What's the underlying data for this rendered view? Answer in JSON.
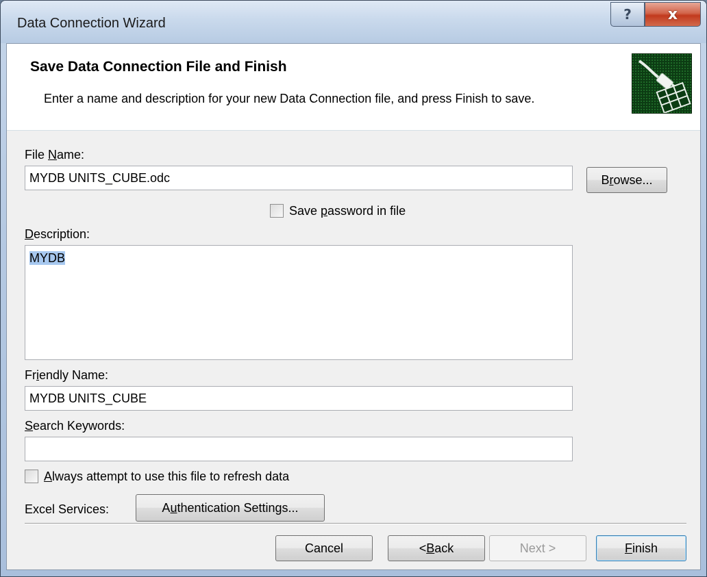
{
  "window": {
    "title": "Data Connection Wizard",
    "help_label": "?",
    "close_label": "x"
  },
  "header": {
    "title": "Save Data Connection File and Finish",
    "description": "Enter a name and description for your new Data Connection file, and press Finish to save.",
    "icon": "data-connection-plug-icon"
  },
  "form": {
    "file_name": {
      "label_pre": "File ",
      "label_u": "N",
      "label_post": "ame:",
      "value": "MYDB UNITS_CUBE.odc"
    },
    "browse": {
      "label_pre": "B",
      "label_u": "r",
      "label_post": "owse..."
    },
    "save_password": {
      "label_pre": "Save ",
      "label_u": "p",
      "label_post": "assword in file",
      "checked": false
    },
    "description": {
      "label_pre": "",
      "label_u": "D",
      "label_post": "escription:",
      "value": "MYDB"
    },
    "friendly_name": {
      "label_pre": "Fr",
      "label_u": "i",
      "label_post": "endly Name:",
      "value": "MYDB UNITS_CUBE"
    },
    "search_keywords": {
      "label_pre": "",
      "label_u": "S",
      "label_post": "earch Keywords:",
      "value": ""
    },
    "always_refresh": {
      "label_pre": "",
      "label_u": "A",
      "label_post": "lways attempt to use this file to refresh data",
      "checked": false
    },
    "excel_services": {
      "label": "Excel Services:"
    },
    "auth_settings": {
      "label_pre": "A",
      "label_u": "u",
      "label_post": "thentication Settings..."
    }
  },
  "footer": {
    "cancel": {
      "label": "Cancel"
    },
    "back": {
      "label_pre": "< ",
      "label_u": "B",
      "label_post": "ack"
    },
    "next": {
      "label": "Next >",
      "disabled": true
    },
    "finish": {
      "label_pre": "",
      "label_u": "F",
      "label_post": "inish"
    }
  },
  "colors": {
    "selection": "#3399ff",
    "icon_background": "#0c3c13",
    "close_button": "#c23a1e"
  }
}
